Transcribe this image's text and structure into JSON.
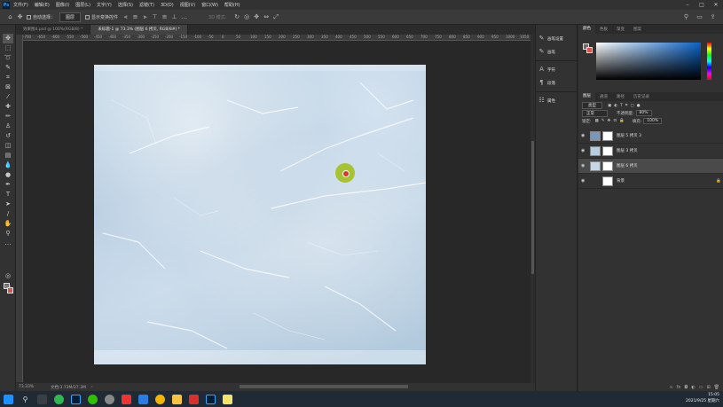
{
  "menubar": {
    "items": [
      "文件(F)",
      "编辑(E)",
      "图像(I)",
      "图层(L)",
      "文字(Y)",
      "选择(S)",
      "滤镜(T)",
      "3D(D)",
      "视图(V)",
      "窗口(W)",
      "帮助(H)"
    ]
  },
  "options": {
    "auto_select_label": "自动选择：",
    "auto_select_value": "图层",
    "show_transform": "显示变换控件",
    "mode3d": "3D 模式："
  },
  "tabs": [
    {
      "label": "效果图4.psd @ 100%(RGB/8) *"
    },
    {
      "label": "未标题-1 @ 73.3% (图层 6 拷贝, RGB/8#) *"
    }
  ],
  "ruler": [
    "-700",
    "-650",
    "-600",
    "-550",
    "-500",
    "-450",
    "-400",
    "-350",
    "-300",
    "-250",
    "-200",
    "-150",
    "-100",
    "-50",
    "0",
    "50",
    "100",
    "150",
    "200",
    "250",
    "300",
    "350",
    "400",
    "450",
    "500",
    "550",
    "600",
    "650",
    "700",
    "750",
    "800",
    "850",
    "900",
    "950",
    "1000",
    "1050",
    "1100"
  ],
  "statusbar": {
    "zoom": "73.33%",
    "doc": "文档:3.73M/27.3M"
  },
  "dock": {
    "items": [
      "画笔设置",
      "画笔",
      "字符",
      "段落",
      "属性"
    ]
  },
  "color_panel": {
    "tabs": [
      "颜色",
      "色板",
      "渐变",
      "图案"
    ]
  },
  "layers_panel": {
    "tabs": [
      "图层",
      "通道",
      "路径",
      "历史记录"
    ],
    "filter_label": "类型",
    "blend_mode": "正常",
    "opacity_label": "不透明度:",
    "opacity": "80%",
    "lock_label": "锁定:",
    "fill_label": "填充:",
    "fill": "100%",
    "layers": [
      {
        "name": "图层 5 拷贝 3",
        "selected": false
      },
      {
        "name": "图层 3 拷贝",
        "selected": false
      },
      {
        "name": "图层 6 拷贝",
        "selected": true
      },
      {
        "name": "背景",
        "selected": false
      }
    ]
  },
  "taskbar": {
    "time": "15:05",
    "date": "2021/9/25 星期六"
  },
  "colors": {
    "fg": "#6b6b6b",
    "bg": "#d9534f",
    "accent": "#31a8ff"
  }
}
